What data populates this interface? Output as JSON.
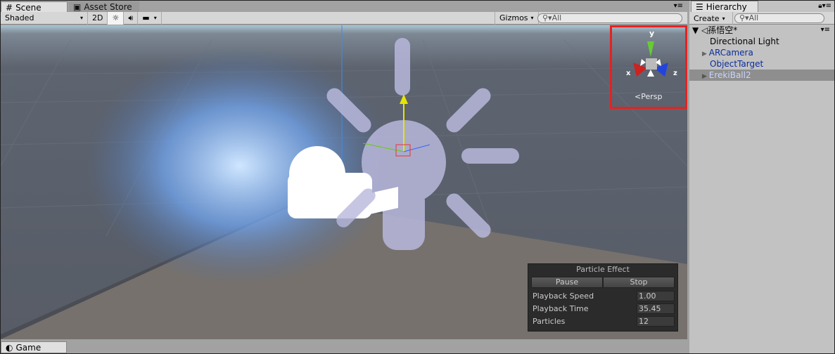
{
  "scene": {
    "tabs": [
      {
        "label": "Scene",
        "icon": "grid-icon"
      },
      {
        "label": "Asset Store",
        "icon": "store-icon"
      }
    ],
    "toolbar": {
      "shading": "Shaded",
      "mode_2d": "2D",
      "gizmos": "Gizmos",
      "search_placeholder": "All"
    },
    "gizmo": {
      "x": "x",
      "y": "y",
      "z": "z",
      "projection": "Persp"
    },
    "particle_effect": {
      "title": "Particle Effect",
      "pause": "Pause",
      "stop": "Stop",
      "rows": [
        {
          "label": "Playback Speed",
          "value": "1.00"
        },
        {
          "label": "Playback Time",
          "value": "35.45"
        },
        {
          "label": "Particles",
          "value": "12"
        }
      ]
    }
  },
  "game": {
    "tab": "Game"
  },
  "hierarchy": {
    "tab": "Hierarchy",
    "create": "Create",
    "search_placeholder": "All",
    "scene_name": "孫悟空*",
    "items": [
      {
        "label": "Directional Light",
        "expandable": false,
        "color": "#000000"
      },
      {
        "label": "ARCamera",
        "expandable": true,
        "color": "#0b2c9c"
      },
      {
        "label": "ObjectTarget",
        "expandable": false,
        "color": "#0b2c9c"
      },
      {
        "label": "ErekiBall2",
        "expandable": true,
        "color": "#c8d6ff",
        "selected": true
      }
    ]
  },
  "colors": {
    "selection_outline": "#e52222",
    "prefab_text": "#0b2c9c"
  }
}
